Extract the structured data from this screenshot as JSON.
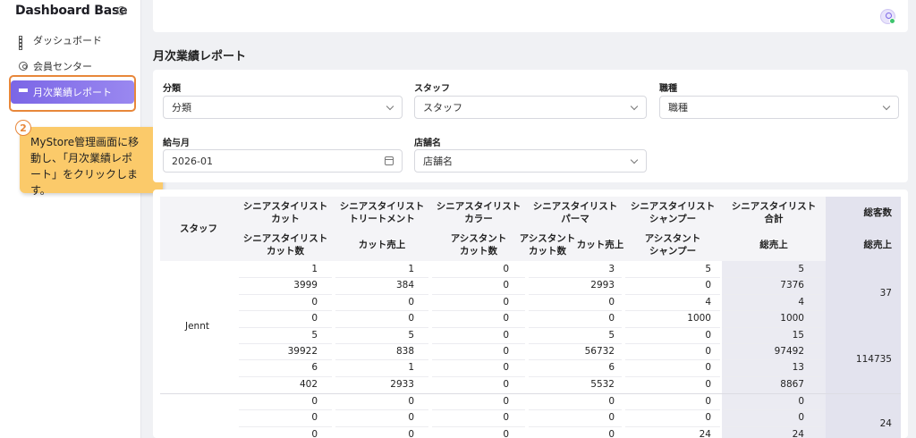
{
  "sidebar": {
    "brand": "Dashboard Base",
    "items": [
      {
        "label": "ダッシュボード"
      },
      {
        "label": "会員センター"
      },
      {
        "label": "月次業績レポート"
      }
    ]
  },
  "callout": {
    "step": "2",
    "line1": "MyStore管理画面に移",
    "line2": "動し、「月次業績レポ",
    "line3": "ート」をクリックします。"
  },
  "page": {
    "title": "月次業績レポート"
  },
  "filters": {
    "category": {
      "label": "分類",
      "value": "分類"
    },
    "staff": {
      "label": "スタッフ",
      "value": "スタッフ"
    },
    "job": {
      "label": "職種",
      "value": "職種"
    },
    "pay_month": {
      "label": "給与月",
      "value": "2026-01"
    },
    "store": {
      "label": "店舗名",
      "value": "店舗名"
    }
  },
  "table": {
    "staff_header": "スタッフ",
    "headers_top": [
      [
        "シニアスタイリスト",
        "カット"
      ],
      [
        "シニアスタイリスト",
        "トリートメント"
      ],
      [
        "シニアスタイリスト",
        "カラー"
      ],
      [
        "シニアスタイリスト",
        "パーマ"
      ],
      [
        "シニアスタイリスト",
        "シャンプー"
      ],
      [
        "シニアスタイリスト",
        "合計"
      ]
    ],
    "headers_sub": [
      [
        "シニアスタイリスト",
        "カット数"
      ],
      [
        "カット売上"
      ],
      [
        "アシスタント",
        "カット数"
      ],
      [
        "アシスタント",
        "カット数"
      ],
      [
        "アシスタント",
        "シャンプー"
      ],
      [
        "総売上"
      ]
    ],
    "perm_sub_right": "カット売上",
    "total_top": "総客数",
    "total_sub": "総売上",
    "groups": [
      {
        "name": "Jennt",
        "rows": [
          [
            "1",
            "1",
            "0",
            "3",
            "5",
            "5"
          ],
          [
            "3999",
            "384",
            "0",
            "2993",
            "0",
            "7376"
          ],
          [
            "0",
            "0",
            "0",
            "0",
            "4",
            "4"
          ],
          [
            "0",
            "0",
            "0",
            "0",
            "1000",
            "1000"
          ],
          [
            "5",
            "5",
            "0",
            "5",
            "0",
            "15"
          ],
          [
            "39922",
            "838",
            "0",
            "56732",
            "0",
            "97492"
          ],
          [
            "6",
            "1",
            "0",
            "6",
            "0",
            "13"
          ],
          [
            "402",
            "2933",
            "0",
            "5532",
            "0",
            "8867"
          ]
        ],
        "total_customers": "37",
        "total_sales": "114735"
      },
      {
        "name": "",
        "rows": [
          [
            "0",
            "0",
            "0",
            "0",
            "0",
            "0"
          ],
          [
            "0",
            "0",
            "0",
            "0",
            "0",
            "0"
          ],
          [
            "0",
            "0",
            "0",
            "0",
            "24",
            "24"
          ]
        ],
        "total_customers": "24",
        "total_sales": ""
      }
    ]
  },
  "colors": {
    "accent": "#7b66e6",
    "highlight": "#e8873a",
    "callout_bg": "#fbca6a"
  }
}
